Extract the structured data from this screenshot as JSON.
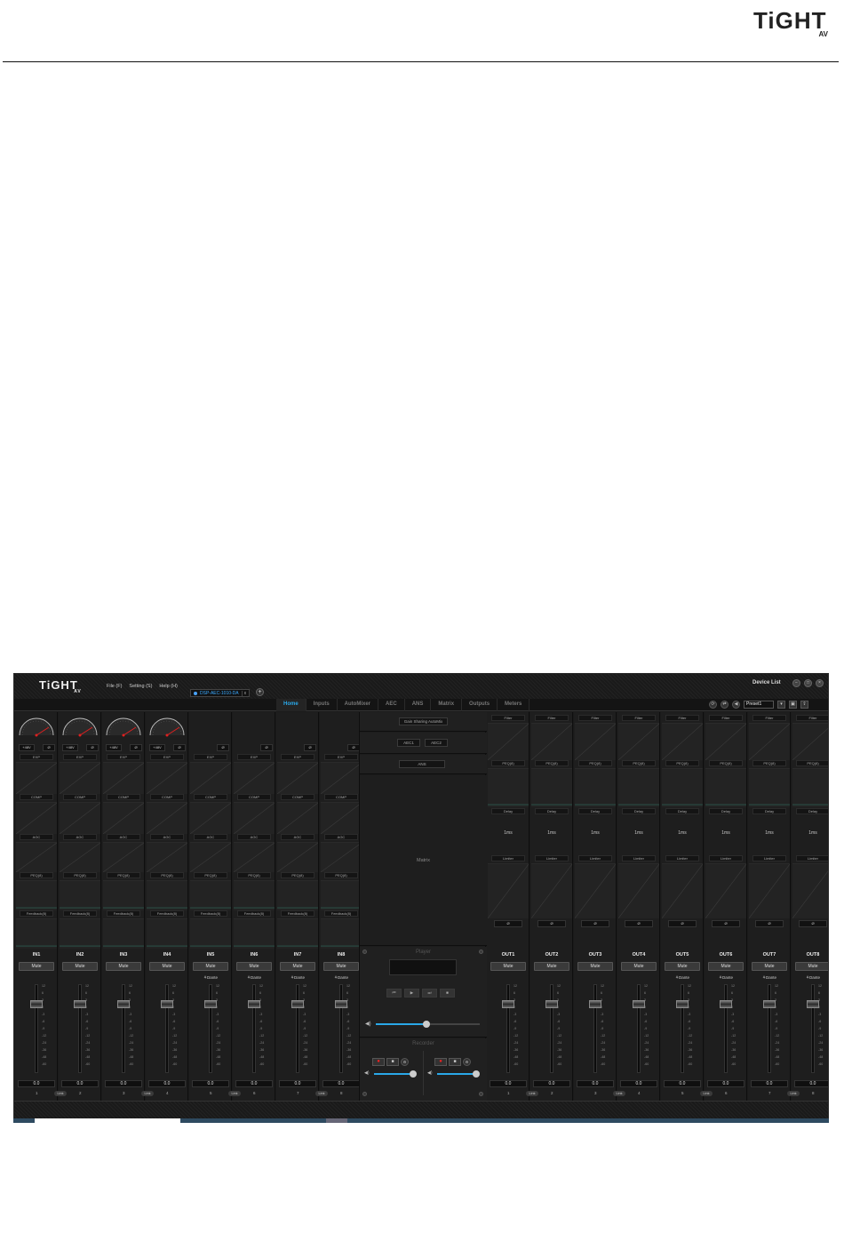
{
  "header": {
    "logo_text": "TiGHT",
    "logo_sub": "AV"
  },
  "app": {
    "logo": "TiGHT",
    "logo_sub": "AV",
    "menu": [
      "File (F)",
      "Setting (S)",
      "Help (H)"
    ],
    "device_tab": "DSP-AEC-1010-DA",
    "device_tab_close": "x",
    "add_tab": "+",
    "device_list": "Device List",
    "window_buttons": [
      "−",
      "□",
      "×"
    ],
    "nav_tabs": [
      "Home",
      "Inputs",
      "AutoMixer",
      "AEC",
      "ANS",
      "Matrix",
      "Outputs",
      "Meters"
    ],
    "active_tab": "Home",
    "preset": "Preset1",
    "accent_color": "#2aa8e8"
  },
  "inputs": [
    {
      "name": "IN1",
      "num": "1",
      "phantom": "+48V",
      "gauge": true,
      "dante": "",
      "value": "0.0",
      "link": false
    },
    {
      "name": "IN2",
      "num": "2",
      "phantom": "+48V",
      "gauge": true,
      "dante": "",
      "value": "0.0",
      "link": true
    },
    {
      "name": "IN3",
      "num": "3",
      "phantom": "+48V",
      "gauge": true,
      "dante": "",
      "value": "0.0",
      "link": false
    },
    {
      "name": "IN4",
      "num": "4",
      "phantom": "+48V",
      "gauge": true,
      "dante": "",
      "value": "0.0",
      "link": true
    },
    {
      "name": "IN5",
      "num": "5",
      "phantom": "",
      "gauge": false,
      "dante": "Dante",
      "value": "0.0",
      "link": false
    },
    {
      "name": "IN6",
      "num": "6",
      "phantom": "",
      "gauge": false,
      "dante": "Dante",
      "value": "0.0",
      "link": true
    },
    {
      "name": "IN7",
      "num": "7",
      "phantom": "",
      "gauge": false,
      "dante": "Dante",
      "value": "0.0",
      "link": false
    },
    {
      "name": "IN8",
      "num": "8",
      "phantom": "",
      "gauge": false,
      "dante": "Dante",
      "value": "0.0",
      "link": true
    }
  ],
  "input_sections": {
    "exp": "EXP",
    "comp": "COMP",
    "agc": "AGC",
    "peq": "PEQ(8)",
    "feedback": "Feedback(8)",
    "phase": "Ø"
  },
  "outputs": [
    {
      "name": "OUT1",
      "num": "1",
      "dante": "",
      "value": "0.0",
      "link": false
    },
    {
      "name": "OUT2",
      "num": "2",
      "dante": "",
      "value": "0.0",
      "link": true
    },
    {
      "name": "OUT3",
      "num": "3",
      "dante": "",
      "value": "0.0",
      "link": false
    },
    {
      "name": "OUT4",
      "num": "4",
      "dante": "",
      "value": "0.0",
      "link": true
    },
    {
      "name": "OUT5",
      "num": "5",
      "dante": "Dante",
      "value": "0.0",
      "link": false
    },
    {
      "name": "OUT6",
      "num": "6",
      "dante": "Dante",
      "value": "0.0",
      "link": true
    },
    {
      "name": "OUT7",
      "num": "7",
      "dante": "Dante",
      "value": "0.0",
      "link": false
    },
    {
      "name": "OUT8",
      "num": "8",
      "dante": "Dante",
      "value": "0.0",
      "link": true
    }
  ],
  "output_sections": {
    "filter": "Filter",
    "peq": "PEQ(8)",
    "delay": "Delay",
    "delay_value": "1ms",
    "limiter": "Limiter",
    "phase": "Ø"
  },
  "mute_label": "Mute",
  "link_label": "Link",
  "fader_scale": [
    "12",
    "6",
    "3",
    "0",
    "-3",
    "-6",
    "-9",
    "-12",
    "-24",
    "-36",
    "-48",
    "-60"
  ],
  "center": {
    "automix": "Gain Sharing AutoMix",
    "aec": [
      "AEC1",
      "AEC2"
    ],
    "ans": "ANS",
    "matrix": "Matrix",
    "player": "Player",
    "recorder": "Recorder",
    "player_buttons": [
      "⏮",
      "▶",
      "⏭",
      "■"
    ]
  }
}
